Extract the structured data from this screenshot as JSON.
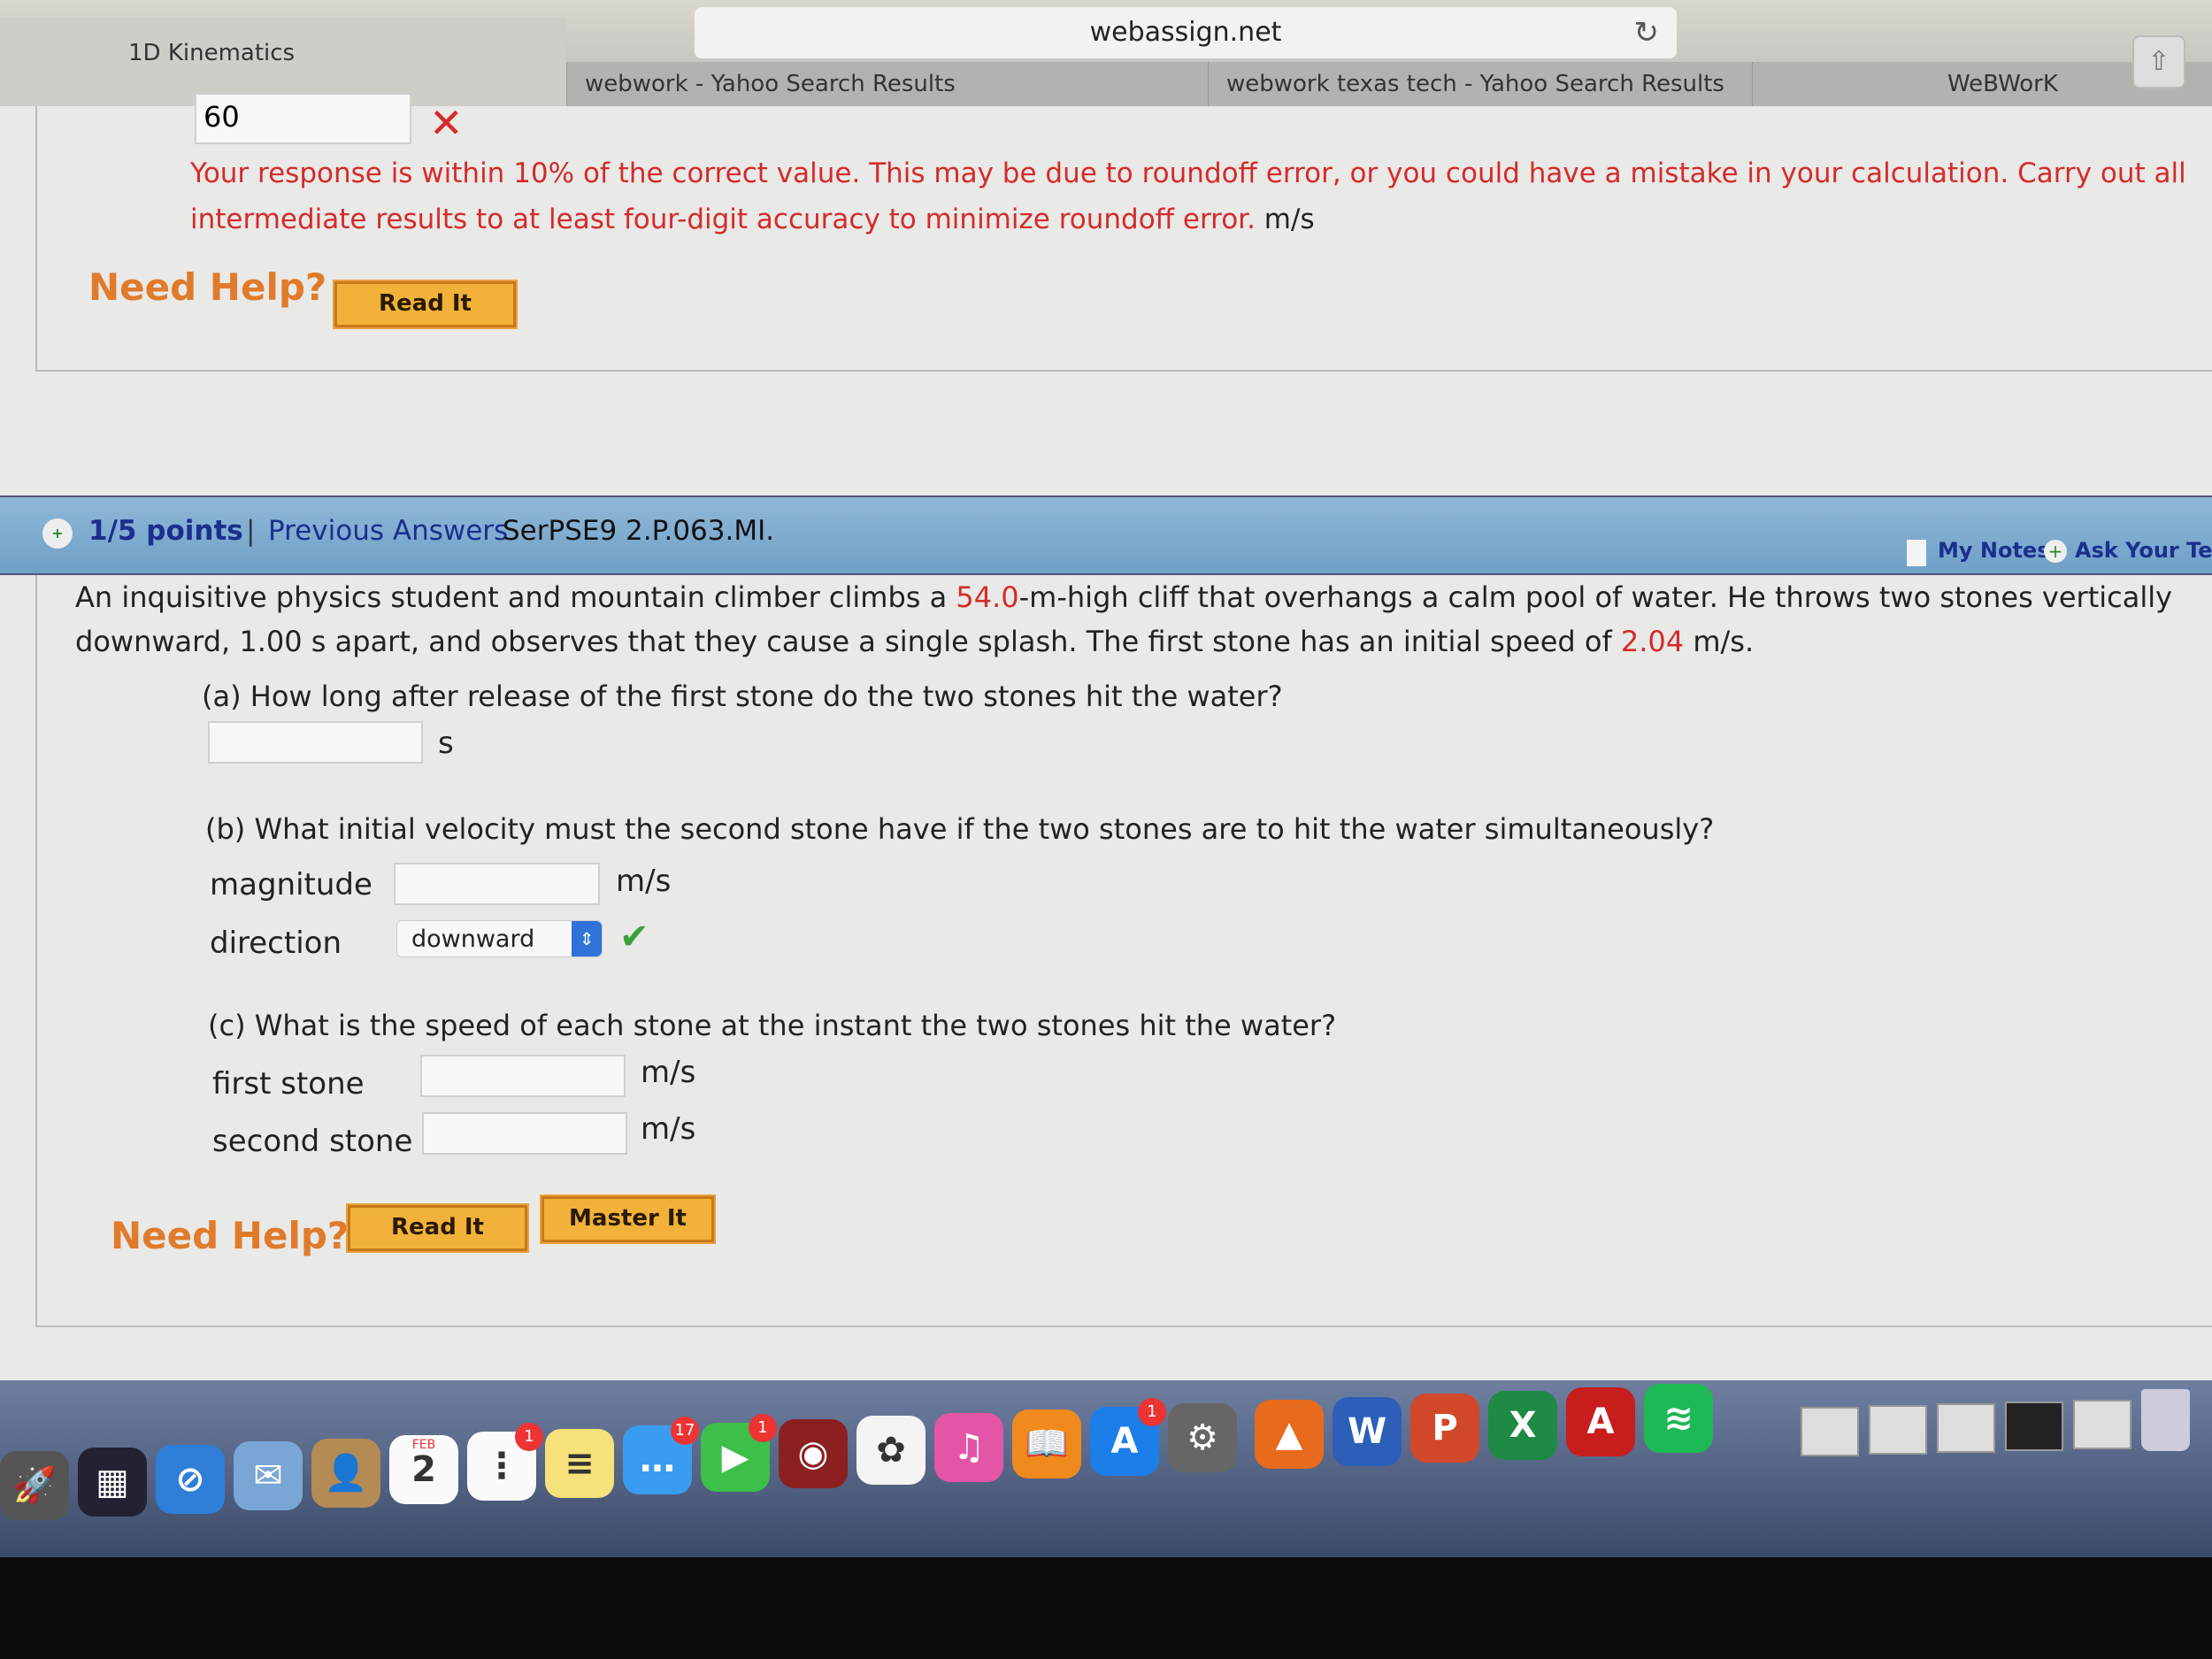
{
  "browser": {
    "url": "webassign.net",
    "tabs": [
      "1D Kinematics",
      "webwork - Yahoo Search Results",
      "webwork texas tech - Yahoo Search Results",
      "WeBWorK"
    ],
    "active_tab": 0
  },
  "prev_question": {
    "answer_value": "60",
    "status": "incorrect",
    "feedback": "Your response is within 10% of the correct value. This may be due to roundoff error, or you could have a mistake in your calculation. Carry out all intermediate results to at least four-digit accuracy to minimize roundoff error.",
    "unit": "m/s",
    "need_help": "Need Help?",
    "read_it": "Read It"
  },
  "question": {
    "points": "1/5 points",
    "previous_answers": "Previous Answers",
    "id": "SerPSE9 2.P.063.MI.",
    "my_notes": "My Notes",
    "ask_teacher": "Ask Your Teach",
    "text_parts": [
      "An inquisitive physics student and mountain climber climbs a ",
      "54.0",
      "-m-high cliff that overhangs a calm pool of water. He throws two stones vertically downward, 1.00 s apart, and observes that they cause a single splash. The first stone has an initial speed of ",
      "2.04",
      " m/s."
    ],
    "part_a": {
      "prompt": "(a) How long after release of the first stone do the two stones hit the water?",
      "value": "",
      "unit": "s"
    },
    "part_b": {
      "prompt": "(b) What initial velocity must the second stone have if the two stones are to hit the water simultaneously?",
      "magnitude_label": "magnitude",
      "magnitude_value": "",
      "magnitude_unit": "m/s",
      "direction_label": "direction",
      "direction_value": "downward",
      "direction_status": "correct"
    },
    "part_c": {
      "prompt": "(c) What is the speed of each stone at the instant the two stones hit the water?",
      "first_label": "first stone",
      "first_value": "",
      "second_label": "second stone",
      "second_value": "",
      "unit": "m/s"
    },
    "need_help": "Need Help?",
    "read_it": "Read It",
    "master_it": "Master It"
  },
  "dock": {
    "items": [
      {
        "name": "launchpad",
        "glyph": "🚀",
        "color": "#555"
      },
      {
        "name": "mission-control",
        "glyph": "▦",
        "color": "#223"
      },
      {
        "name": "safari",
        "glyph": "⊘",
        "color": "#2f7fd8"
      },
      {
        "name": "mail",
        "glyph": "✉",
        "color": "#7aa6d6"
      },
      {
        "name": "contacts",
        "glyph": "👤",
        "color": "#b48a55"
      },
      {
        "name": "calendar",
        "glyph": "2",
        "color": "#fafafa",
        "label": "FEB"
      },
      {
        "name": "reminders",
        "glyph": "⋮",
        "color": "#fafafa",
        "badge": "1"
      },
      {
        "name": "notes",
        "glyph": "≡",
        "color": "#f6e27a"
      },
      {
        "name": "messages",
        "glyph": "…",
        "color": "#3a9cf0",
        "badge": "17"
      },
      {
        "name": "facetime",
        "glyph": "▶",
        "color": "#3cc04a",
        "badge": "1"
      },
      {
        "name": "photo-booth",
        "glyph": "◉",
        "color": "#8a2020"
      },
      {
        "name": "photos",
        "glyph": "✿",
        "color": "#f4f4f4"
      },
      {
        "name": "itunes",
        "glyph": "♫",
        "color": "#e455a8"
      },
      {
        "name": "ibooks",
        "glyph": "📖",
        "color": "#f08a1c"
      },
      {
        "name": "app-store",
        "glyph": "A",
        "color": "#1c7ee8",
        "badge": "1"
      },
      {
        "name": "system-preferences",
        "glyph": "⚙",
        "color": "#666"
      },
      {
        "name": "matlab",
        "glyph": "▲",
        "color": "#e86a1c"
      },
      {
        "name": "word",
        "glyph": "W",
        "color": "#2b5fb8"
      },
      {
        "name": "powerpoint",
        "glyph": "P",
        "color": "#d2482a"
      },
      {
        "name": "excel",
        "glyph": "X",
        "color": "#1f8a45"
      },
      {
        "name": "acrobat",
        "glyph": "A",
        "color": "#c81d1d"
      },
      {
        "name": "spotify",
        "glyph": "≋",
        "color": "#1db954"
      }
    ]
  }
}
